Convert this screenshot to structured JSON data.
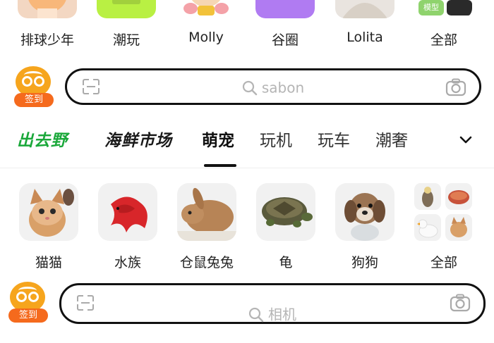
{
  "top_categories": [
    {
      "label": "排球少年",
      "icon": "anime-character-icon",
      "color": "#f3d7c2"
    },
    {
      "label": "潮玩",
      "icon": "trend-toy-icon",
      "color": "#b9f043"
    },
    {
      "label": "Molly",
      "icon": "molly-figure-icon",
      "color": "#ffffff"
    },
    {
      "label": "谷圈",
      "icon": "goods-icon",
      "color": "#b07bf2"
    },
    {
      "label": "Lolita",
      "icon": "lolita-icon",
      "color": "#e9e4df"
    },
    {
      "label": "全部",
      "icon": "all-categories-icon",
      "color": "#ffffff"
    }
  ],
  "model_tag": "模型",
  "checkin": {
    "label": "签到"
  },
  "search_top": {
    "placeholder": "sabon"
  },
  "tabs": [
    {
      "label": "出去野",
      "style": "brand",
      "color": "#1aa83a"
    },
    {
      "label": "海鲜市场",
      "style": "brand"
    },
    {
      "label": "萌宠",
      "style": "active"
    },
    {
      "label": "玩机",
      "style": "normal"
    },
    {
      "label": "玩车",
      "style": "normal"
    },
    {
      "label": "潮奢",
      "style": "normal"
    }
  ],
  "pets": [
    {
      "label": "猫猫",
      "icon": "cat-icon"
    },
    {
      "label": "水族",
      "icon": "betta-fish-icon"
    },
    {
      "label": "仓鼠兔兔",
      "icon": "rabbit-icon"
    },
    {
      "label": "龟",
      "icon": "turtle-icon"
    },
    {
      "label": "狗狗",
      "icon": "dog-icon"
    },
    {
      "label": "全部",
      "icon": "all-pets-icon"
    }
  ],
  "search_bottom": {
    "placeholder": "相机"
  },
  "colors": {
    "accent_orange": "#f56a1d",
    "checkin_yellow": "#f6a51d",
    "brand_green": "#1aa83a"
  }
}
